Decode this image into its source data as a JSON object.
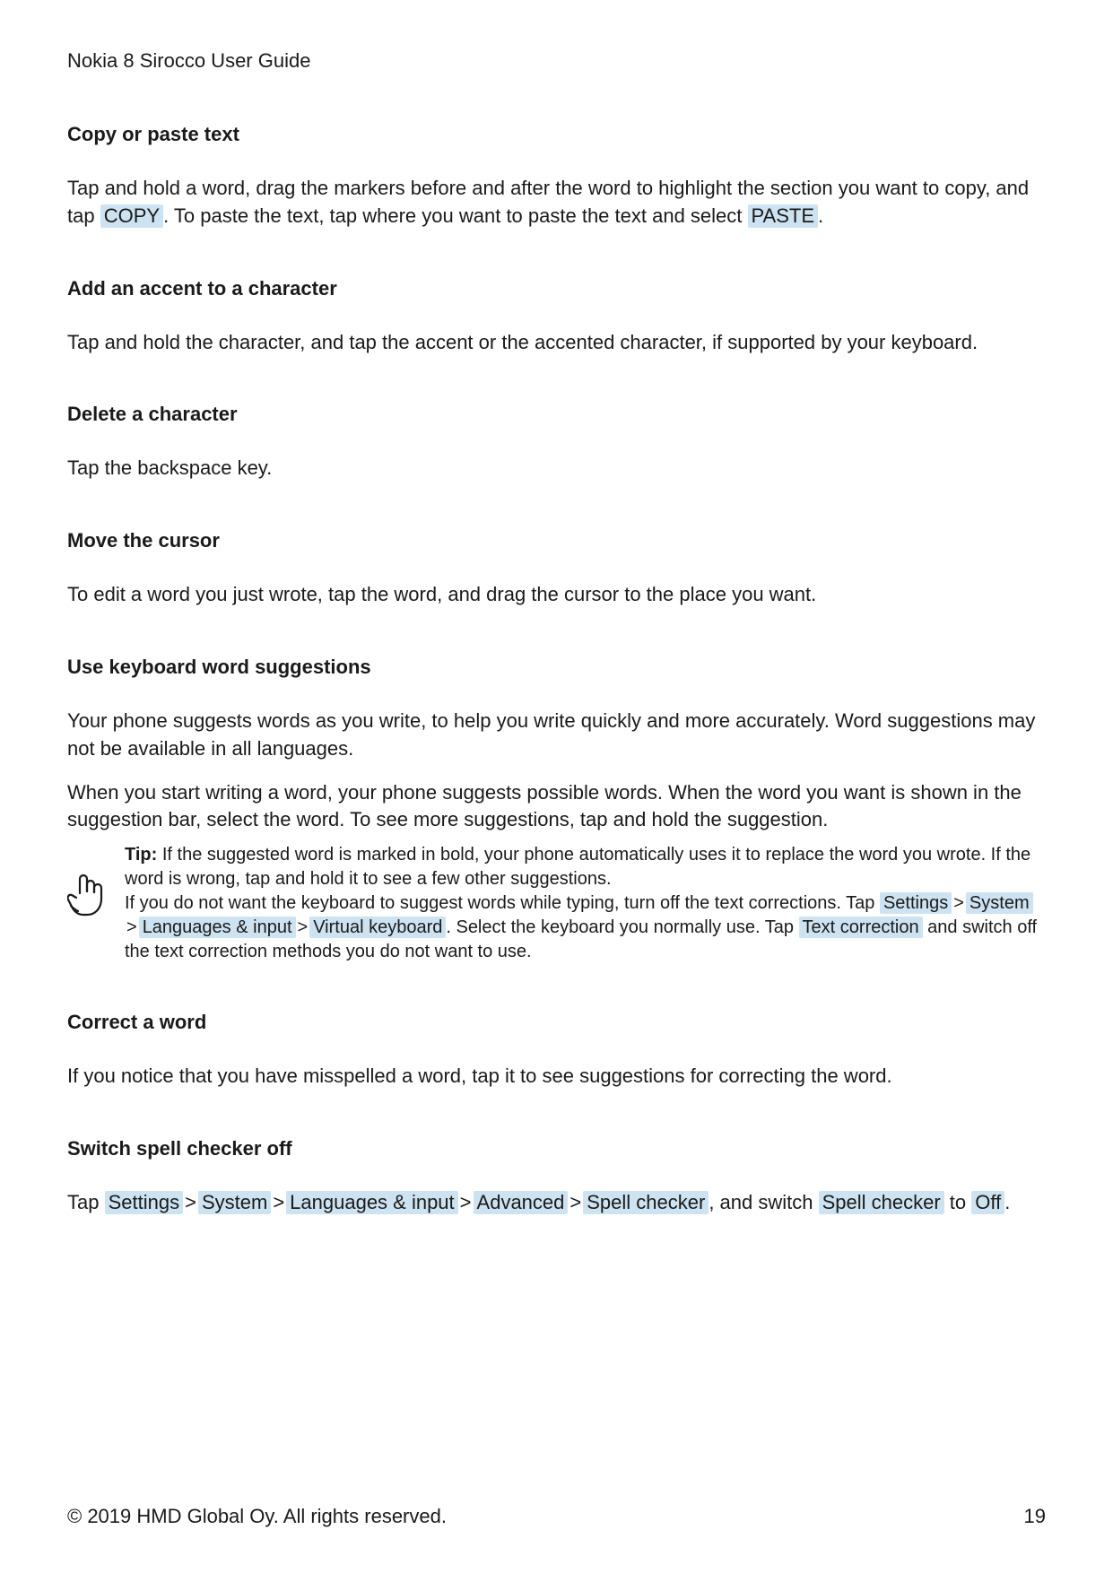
{
  "header": {
    "title": "Nokia 8 Sirocco User Guide"
  },
  "sections": {
    "copy_paste": {
      "heading": "Copy or paste text",
      "text_before_copy": "Tap and hold a word, drag the markers before and after the word to highlight the section you want to copy, and tap ",
      "copy_label": "COPY",
      "text_after_copy": ". To paste the text, tap where you want to paste the text and select ",
      "paste_label": "PASTE",
      "text_end": "."
    },
    "accent": {
      "heading": "Add an accent to a character",
      "body": "Tap and hold the character, and tap the accent or the accented character, if supported by your keyboard."
    },
    "delete": {
      "heading": "Delete a character",
      "body": "Tap the backspace key."
    },
    "cursor": {
      "heading": "Move the cursor",
      "body": "To edit a word you just wrote, tap the word, and drag the cursor to the place you want."
    },
    "suggestions": {
      "heading": "Use keyboard word suggestions",
      "p1": "Your phone suggests words as you write, to help you write quickly and more accurately. Word suggestions may not be available in all languages.",
      "p2": "When you start writing a word, your phone suggests possible words. When the word you want is shown in the suggestion bar, select the word. To see more suggestions, tap and hold the suggestion.",
      "tip_label": "Tip:",
      "tip_line1": " If the suggested word is marked in bold, your phone automatically uses it to replace the word you wrote. If the word is wrong, tap and hold it to see a few other suggestions.",
      "tip_line2a": "If you do not want the keyboard to suggest words while typing, turn off the text corrections. Tap ",
      "hl_settings": "Settings",
      "hl_system": "System",
      "hl_langinput": "Languages & input",
      "hl_vkeyboard": "Virtual keyboard",
      "tip_line2b": ". Select the keyboard you normally use. Tap ",
      "hl_textcorr": "Text correction",
      "tip_line2c": " and switch off the text correction methods you do not want to use.",
      "separator": ">"
    },
    "correct": {
      "heading": "Correct a word",
      "body": "If you notice that you have misspelled a word, tap it to see suggestions for correcting the word."
    },
    "spellcheck": {
      "heading": "Switch spell checker off",
      "text_a": "Tap ",
      "hl_settings": "Settings",
      "hl_system": "System",
      "hl_langinput": "Languages & input",
      "hl_advanced": "Advanced",
      "hl_spell": "Spell checker",
      "text_b": ", and switch ",
      "hl_spell2": "Spell checker",
      "text_c": " to ",
      "hl_off": "Off",
      "text_d": ".",
      "separator": ">"
    }
  },
  "footer": {
    "copyright": "© 2019 HMD Global Oy. All rights reserved.",
    "page": "19"
  }
}
